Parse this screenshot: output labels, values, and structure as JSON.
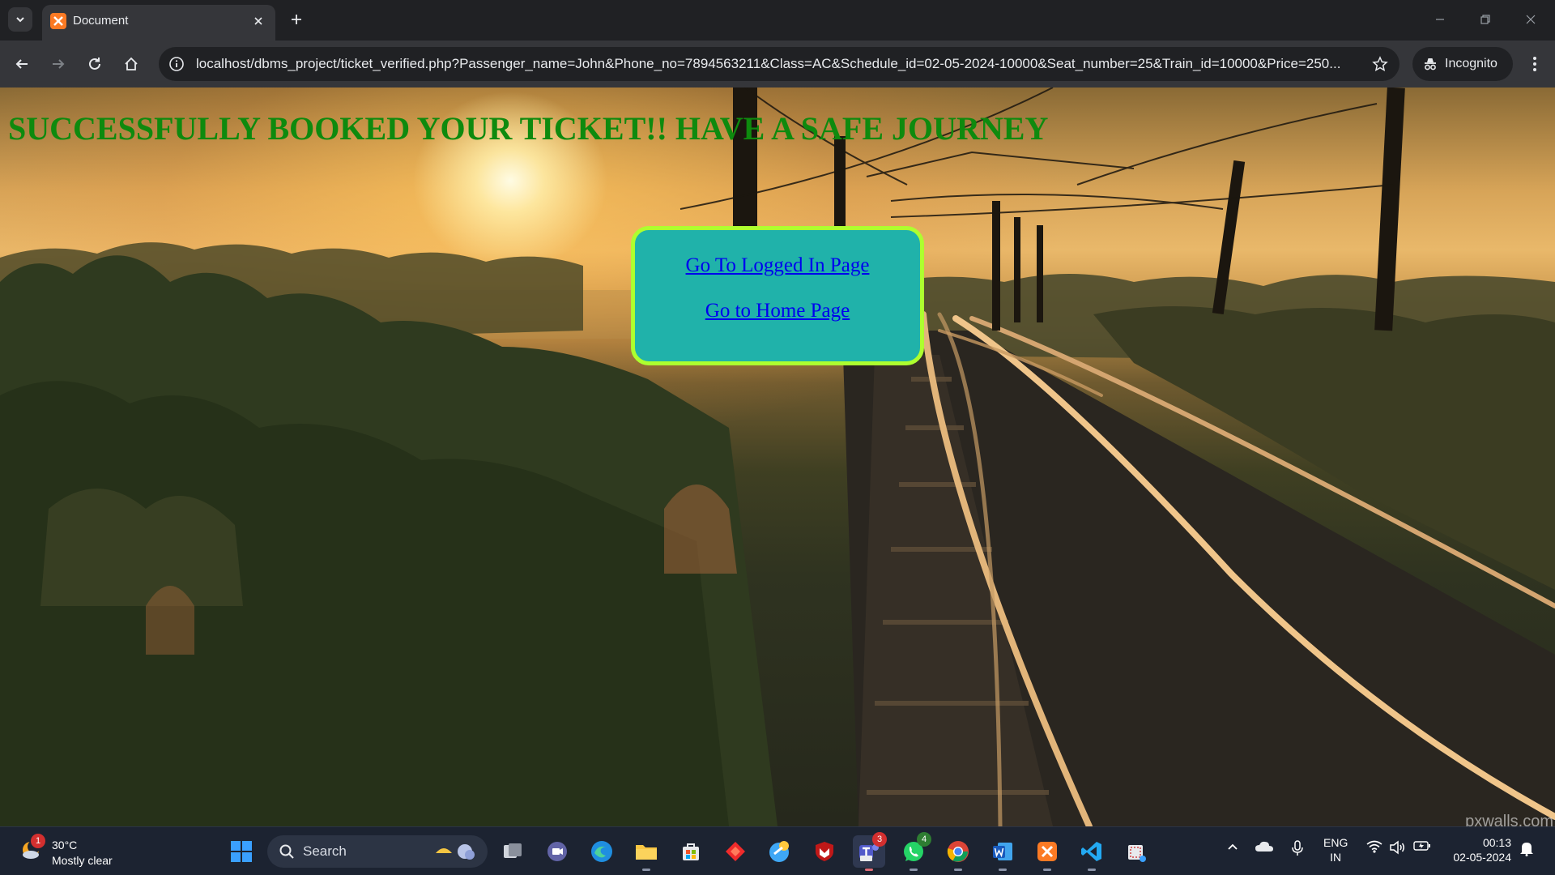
{
  "browser": {
    "tab_title": "Document",
    "url_host": "localhost",
    "url_rest": "/dbms_project/ticket_verified.php?Passenger_name=John&Phone_no=7894563211&Class=AC&Schedule_id=02-05-2024-10000&Seat_number=25&Train_id=10000&Price=250...",
    "incognito_label": "Incognito"
  },
  "page": {
    "headline": "SUCCESSFULLY BOOKED YOUR TICKET!! HAVE A SAFE JOURNEY",
    "links": {
      "logged_in": "Go To Logged In Page",
      "home": "Go to Home Page"
    },
    "watermark": "pxwalls.com"
  },
  "taskbar": {
    "weather_temp": "30°C",
    "weather_desc": "Mostly clear",
    "weather_badge": "1",
    "search_label": "Search",
    "teams_badge": "3",
    "whatsapp_badge": "4",
    "lang_line1": "ENG",
    "lang_line2": "IN",
    "time": "00:13",
    "date": "02-05-2024"
  },
  "colors": {
    "headline": "#0e8a0e",
    "box_background": "#20b2aa",
    "box_border": "#adff2f",
    "link": "#0000ee"
  }
}
